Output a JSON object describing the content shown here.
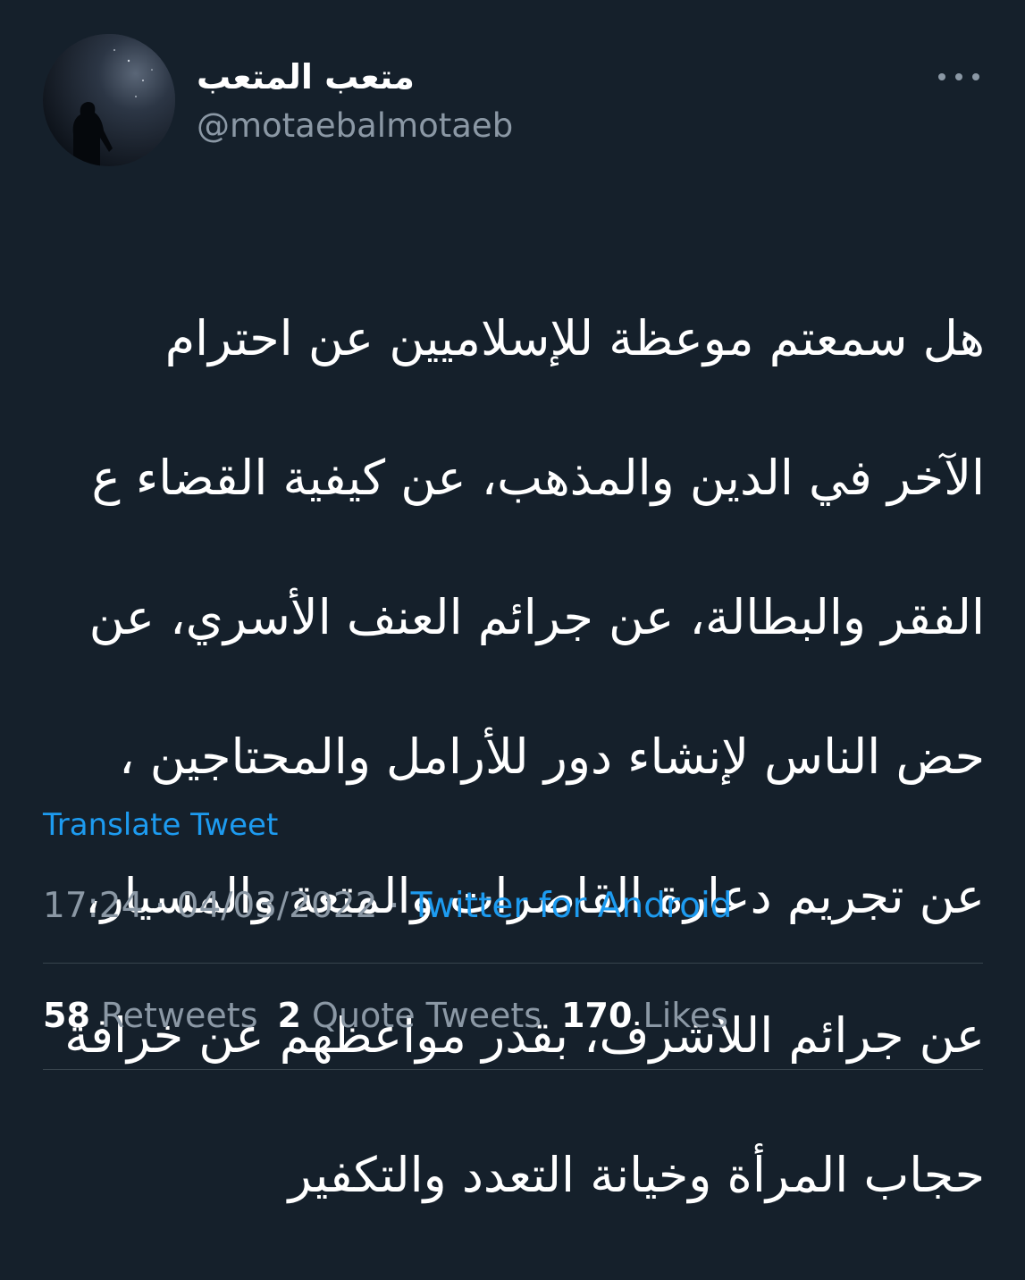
{
  "user": {
    "display_name": "متعب المتعب",
    "handle": "@motaebalmotaeb"
  },
  "tweet": {
    "text_lines": [
      "هل سمعتم موعظة للإسلاميين عن احترام",
      "الآخر في الدين والمذهب، عن كيفية القضاء ع",
      "الفقر والبطالة، عن جرائم العنف الأسري، عن",
      "حض الناس لإنشاء دور للأرامل والمحتاجين ،",
      "عن تجريم دعارة القاصرات والمتعة والمسيار،",
      "عن جرائم اللاشرف، بقدر مواعظهم عن خرافة",
      "حجاب المرأة وخيانة التعدد والتكفير"
    ],
    "translate_label": "Translate Tweet",
    "time": "17:24",
    "date": "04/03/2022",
    "separator": "·",
    "source": "Twitter for Android"
  },
  "stats": {
    "retweets_count": "58",
    "retweets_label": "Retweets",
    "quotes_count": "2",
    "quotes_label": "Quote Tweets",
    "likes_count": "170",
    "likes_label": "Likes"
  },
  "icons": {
    "more": "more-horizontal-icon"
  },
  "colors": {
    "background": "#15202b",
    "link": "#1d9bf0",
    "secondary_text": "#8b98a5",
    "divider": "#38444d"
  }
}
